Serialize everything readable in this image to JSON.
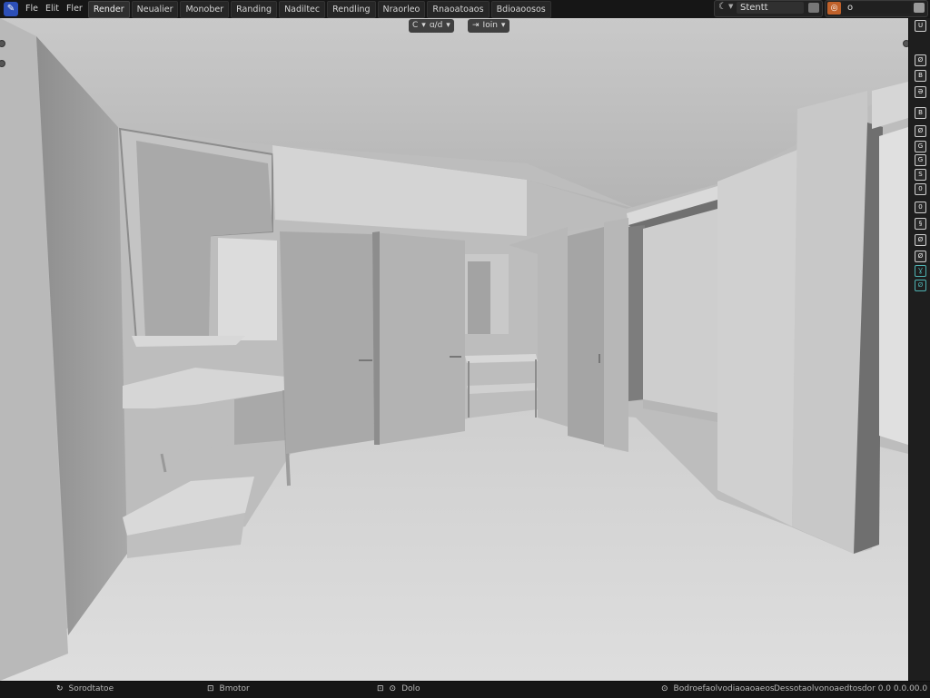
{
  "menu": {
    "items": [
      "Fle",
      "Elit",
      "Fler"
    ],
    "workspace_tabs": [
      "Render",
      "Neualier",
      "Monober",
      "Randing",
      "Nadiltec",
      "Rendling",
      "Nraorleo",
      "Rnaoatoaos",
      "Bdioaoosos"
    ],
    "active_tab_index": 0
  },
  "scene": {
    "name": "Stentt"
  },
  "view_layer": {
    "name": "o"
  },
  "viewport_header": {
    "left_icon": "C",
    "left_label": "ɑ/d",
    "right_label": "Ioin"
  },
  "right_toolbar": {
    "icons": [
      "cursor-icon",
      "move-icon",
      "rotate-icon",
      "scale-icon",
      "transform-icon",
      "annotate-icon",
      "measure-icon",
      "add-cube-icon",
      "cut-icon",
      "extrude-icon",
      "inset-icon",
      "bevel-icon",
      "loop-cut-icon",
      "knife-icon",
      "poly-build-icon",
      "spin-icon"
    ],
    "labels": [
      "U",
      "Ø",
      "B",
      "Ə",
      "B",
      "Ø",
      "G",
      "G",
      "S",
      "0",
      "0",
      "§",
      "Ø",
      "Ø",
      "Ɣ",
      "Ø"
    ]
  },
  "status": {
    "left_icon": "↻",
    "left_text": "Sorodtatoe",
    "mid1_icon": "⊡",
    "mid1_text": "Bmotor",
    "mid2_icon": "⊡",
    "mid2_icon2": "⊙",
    "mid2_text": "Dolo",
    "right1_text": "Bodroefaolvodiaoaoaeos",
    "right2_text": "Dessotaolvonoaedtosdor 0.0 0.0.00.0"
  },
  "colors": {
    "logo": "#2c4fb7",
    "view_layer_icon": "#c0612a",
    "accent_teal": "#4fb3b3"
  }
}
